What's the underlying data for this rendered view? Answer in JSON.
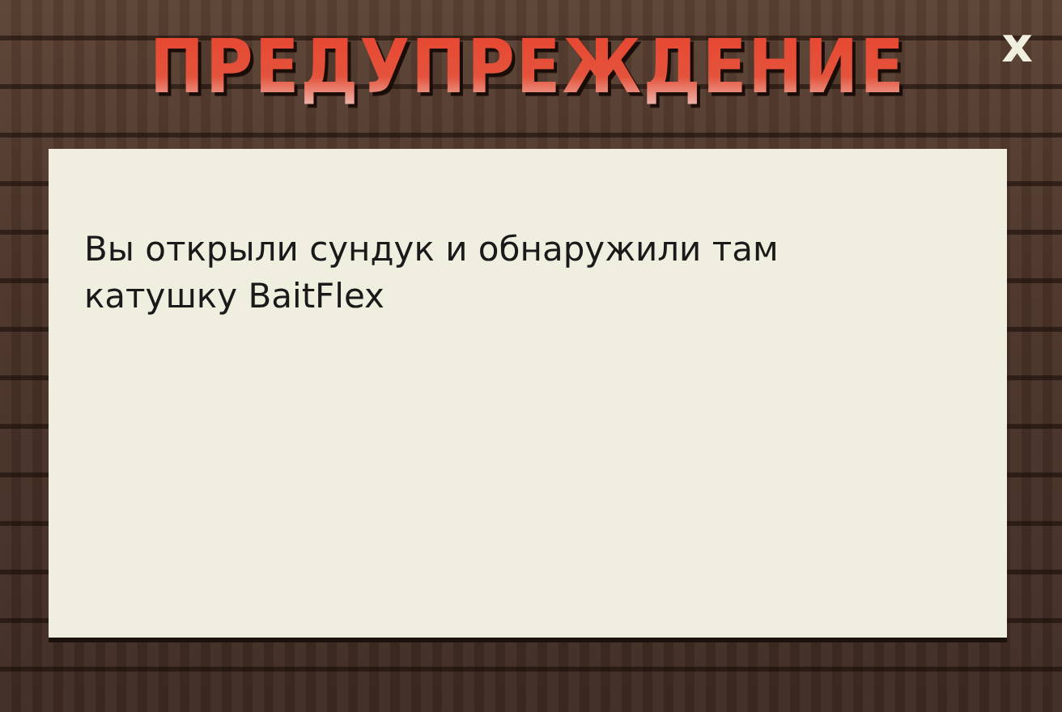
{
  "window": {
    "title": "ПРЕДУПРЕЖДЕНИЕ",
    "close": "x"
  },
  "message": "Вы открыли сундук и обнаружили там катушку BaitFlex"
}
